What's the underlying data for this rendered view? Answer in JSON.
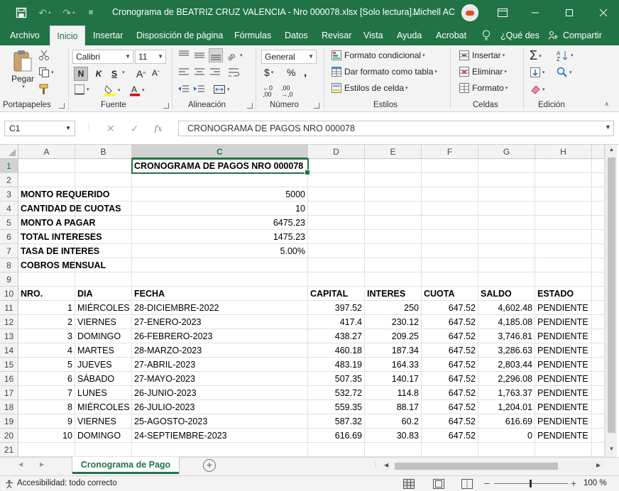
{
  "titlebar": {
    "title": "Cronograma de BEATRIZ CRUZ VALENCIA - Nro 000078.xlsx  [Solo lectura]...",
    "user": "Michell AC",
    "save_icon": "save-icon",
    "undo_icon": "undo-icon",
    "redo_icon": "redo-icon"
  },
  "tabs": [
    "Archivo",
    "Inicio",
    "Insertar",
    "Disposición de página",
    "Fórmulas",
    "Datos",
    "Revisar",
    "Vista",
    "Ayuda",
    "Acrobat"
  ],
  "tell_me": "¿Qué des",
  "share": "Compartir",
  "ribbon": {
    "paste": "Pegar",
    "font_name": "Calibri",
    "font_size": "11",
    "bold": "N",
    "italic": "K",
    "underline": "S",
    "number_format": "General",
    "cond_format": "Formato condicional",
    "table_format": "Dar formato como tabla",
    "cell_styles": "Estilos de celda",
    "insert": "Insertar",
    "delete": "Eliminar",
    "format": "Formato",
    "groups": {
      "clipboard": "Portapapeles",
      "font": "Fuente",
      "alignment": "Alineación",
      "number": "Número",
      "styles": "Estilos",
      "cells": "Celdas",
      "editing": "Edición"
    }
  },
  "formula_bar": {
    "name_box": "C1",
    "formula": "CRONOGRAMA DE PAGOS NRO 000078"
  },
  "columns": [
    "A",
    "B",
    "C",
    "D",
    "E",
    "F",
    "G",
    "H"
  ],
  "rows": [
    "1",
    "2",
    "3",
    "4",
    "5",
    "6",
    "7",
    "8",
    "9",
    "10",
    "11",
    "12",
    "13",
    "14",
    "15",
    "16",
    "17",
    "18",
    "19",
    "20",
    "21"
  ],
  "sheet": {
    "title": "CRONOGRAMA DE PAGOS NRO 000078",
    "summary": [
      {
        "label": "MONTO REQUERIDO",
        "value": "5000"
      },
      {
        "label": "CANTIDAD DE CUOTAS",
        "value": "10"
      },
      {
        "label": "MONTO A PAGAR",
        "value": "6475.23"
      },
      {
        "label": "TOTAL INTERESES",
        "value": "1475.23"
      },
      {
        "label": "TASA DE INTERES",
        "value": "5.00%"
      },
      {
        "label": "COBROS MENSUAL",
        "value": ""
      }
    ],
    "headers": [
      "NRO.",
      "DIA",
      "FECHA",
      "CAPITAL",
      "INTERES",
      "CUOTA",
      "SALDO",
      "ESTADO"
    ],
    "schedule": [
      [
        "1",
        "MIÉRCOLES",
        "28-DICIEMBRE-2022",
        "397.52",
        "250",
        "647.52",
        "4,602.48",
        "PENDIENTE"
      ],
      [
        "2",
        "VIERNES",
        "27-ENERO-2023",
        "417.4",
        "230.12",
        "647.52",
        "4,185.08",
        "PENDIENTE"
      ],
      [
        "3",
        "DOMINGO",
        "26-FEBRERO-2023",
        "438.27",
        "209.25",
        "647.52",
        "3,746.81",
        "PENDIENTE"
      ],
      [
        "4",
        "MARTES",
        "28-MARZO-2023",
        "460.18",
        "187.34",
        "647.52",
        "3,286.63",
        "PENDIENTE"
      ],
      [
        "5",
        "JUEVES",
        "27-ABRIL-2023",
        "483.19",
        "164.33",
        "647.52",
        "2,803.44",
        "PENDIENTE"
      ],
      [
        "6",
        "SÁBADO",
        "27-MAYO-2023",
        "507.35",
        "140.17",
        "647.52",
        "2,296.08",
        "PENDIENTE"
      ],
      [
        "7",
        "LUNES",
        "26-JUNIO-2023",
        "532.72",
        "114.8",
        "647.52",
        "1,763.37",
        "PENDIENTE"
      ],
      [
        "8",
        "MIÉRCOLES",
        "26-JULIO-2023",
        "559.35",
        "88.17",
        "647.52",
        "1,204.01",
        "PENDIENTE"
      ],
      [
        "9",
        "VIERNES",
        "25-AGOSTO-2023",
        "587.32",
        "60.2",
        "647.52",
        "616.69",
        "PENDIENTE"
      ],
      [
        "10",
        "DOMINGO",
        "24-SEPTIEMBRE-2023",
        "616.69",
        "30.83",
        "647.52",
        "0",
        "PENDIENTE"
      ]
    ]
  },
  "sheet_tab": "Cronograma de Pago",
  "status": {
    "accessibility": "Accesibilidad: todo correcto",
    "zoom": "100 %"
  },
  "colors": {
    "excel_green": "#217346",
    "ribbon_bg": "#f3f3f3"
  }
}
